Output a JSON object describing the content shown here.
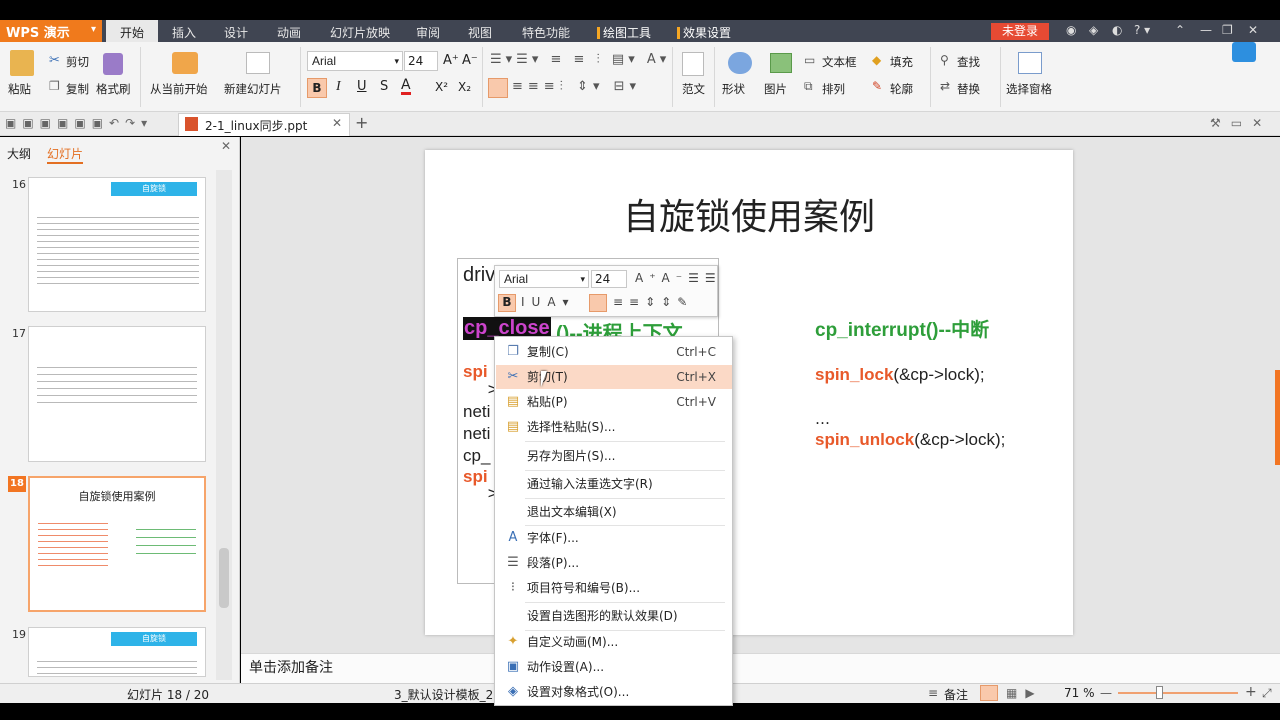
{
  "app": {
    "name": "WPS 演示",
    "menu_tabs": [
      "开始",
      "插入",
      "设计",
      "动画",
      "幻灯片放映",
      "审阅",
      "视图",
      "特色功能"
    ],
    "tool_tabs": [
      "绘图工具",
      "效果设置"
    ],
    "login_label": "未登录"
  },
  "ribbon": {
    "paste": "粘贴",
    "cut": "剪切",
    "copy": "复制",
    "format_painter": "格式刷",
    "from_start": "从当前开始",
    "new_slide": "新建幻灯片",
    "font_name": "Arial",
    "font_size": "24",
    "bold": "B",
    "italic": "I",
    "underline": "U",
    "strike": "S",
    "font_color": "A",
    "superscript": "X²",
    "subscript": "X₂",
    "template": "范文",
    "shape": "形状",
    "picture": "图片",
    "textbox": "文本框",
    "arrange": "排列",
    "fill": "填充",
    "outline": "轮廓",
    "find": "查找",
    "replace": "替换",
    "selection_pane": "选择窗格"
  },
  "doc_tab": {
    "title": "2-1_linux同步.ppt"
  },
  "panel": {
    "tab_outline": "大纲",
    "tab_slides": "幻灯片",
    "thumbs": [
      {
        "num": "16",
        "title": "自旋锁"
      },
      {
        "num": "17",
        "title": ""
      },
      {
        "num": "18",
        "title": "自旋锁使用案例"
      },
      {
        "num": "19",
        "title": "自旋锁"
      }
    ]
  },
  "slide": {
    "title": "自旋锁使用案例",
    "left_line1": "driv",
    "left_close_fn": "cp_close",
    "left_close_rest": "()--进程上下文",
    "left_spin1": "spi",
    "left_gt1": ">",
    "left_neti1": "neti",
    "left_neti2": "neti",
    "left_cp": "cp_",
    "left_spin2": "spi",
    "left_gt2": ">",
    "right_interrupt": "cp_interrupt()--中断",
    "right_lock_fn": "spin_lock",
    "right_lock_arg": "(&cp->lock);",
    "right_ellipsis": "…",
    "right_unlock_fn": "spin_unlock",
    "right_unlock_arg": "(&cp->lock);"
  },
  "minibar": {
    "font": "Arial",
    "size": "24"
  },
  "context_menu": [
    {
      "label": "复制(C)",
      "shortcut": "Ctrl+C",
      "icon": "copy-icon"
    },
    {
      "label": "剪切(T)",
      "shortcut": "Ctrl+X",
      "icon": "scissors-icon"
    },
    {
      "label": "粘贴(P)",
      "shortcut": "Ctrl+V",
      "icon": "paste-icon"
    },
    {
      "label": "选择性粘贴(S)...",
      "shortcut": "",
      "icon": "paste-special-icon"
    },
    {
      "label": "另存为图片(S)...",
      "shortcut": "",
      "icon": ""
    },
    {
      "label": "通过输入法重选文字(R)",
      "shortcut": "",
      "icon": ""
    },
    {
      "label": "退出文本编辑(X)",
      "shortcut": "",
      "icon": ""
    },
    {
      "label": "字体(F)...",
      "shortcut": "",
      "icon": "font-icon"
    },
    {
      "label": "段落(P)...",
      "shortcut": "",
      "icon": "paragraph-icon"
    },
    {
      "label": "项目符号和编号(B)...",
      "shortcut": "",
      "icon": "bullets-icon"
    },
    {
      "label": "设置自选图形的默认效果(D)",
      "shortcut": "",
      "icon": ""
    },
    {
      "label": "自定义动画(M)...",
      "shortcut": "",
      "icon": "animation-icon"
    },
    {
      "label": "动作设置(A)...",
      "shortcut": "",
      "icon": "action-icon"
    },
    {
      "label": "设置对象格式(O)...",
      "shortcut": "",
      "icon": "format-icon"
    }
  ],
  "notes": {
    "placeholder": "单击添加备注"
  },
  "status": {
    "slide_pos": "幻灯片 18 / 20",
    "template": "3_默认设计模板_2",
    "notes": "备注",
    "zoom": "71 %"
  },
  "colors": {
    "accent": "#f07a1c",
    "titlebar": "#404552",
    "green": "#2e9e3a",
    "orange": "#e8592a",
    "highlight": "#fbd9c6"
  }
}
